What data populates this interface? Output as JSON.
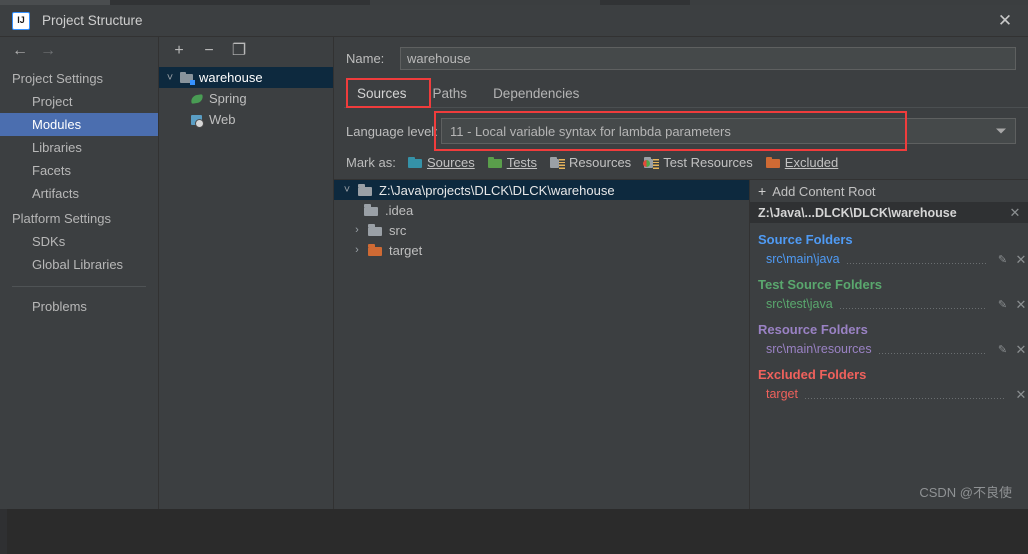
{
  "window": {
    "title": "Project Structure",
    "app_icon": "intellij-idea-icon",
    "close_label": "✕"
  },
  "nav": {
    "back_icon": "arrow-left-icon",
    "forward_icon": "arrow-right-icon"
  },
  "sidebar": {
    "groups": [
      {
        "label": "Project Settings",
        "items": [
          {
            "label": "Project",
            "selected": false
          },
          {
            "label": "Modules",
            "selected": true
          },
          {
            "label": "Libraries",
            "selected": false
          },
          {
            "label": "Facets",
            "selected": false
          },
          {
            "label": "Artifacts",
            "selected": false
          }
        ]
      },
      {
        "label": "Platform Settings",
        "items": [
          {
            "label": "SDKs",
            "selected": false
          },
          {
            "label": "Global Libraries",
            "selected": false
          }
        ]
      }
    ],
    "problems": {
      "label": "Problems"
    }
  },
  "modules_panel": {
    "toolbar": {
      "add": "+",
      "remove": "−",
      "copy": "❐"
    },
    "tree": [
      {
        "label": "warehouse",
        "icon": "module-folder-icon",
        "expanded": true,
        "selected": true,
        "level": 0
      },
      {
        "label": "Spring",
        "icon": "spring-leaf-icon",
        "level": 1
      },
      {
        "label": "Web",
        "icon": "web-icon",
        "level": 1
      }
    ]
  },
  "main": {
    "name": {
      "label": "Name:",
      "value": "warehouse"
    },
    "tabs": [
      {
        "label": "Sources",
        "active": true,
        "highlighted": true
      },
      {
        "label": "Paths",
        "active": false
      },
      {
        "label": "Dependencies",
        "active": false
      }
    ],
    "language_level": {
      "label": "Language level:",
      "value": "11 - Local variable syntax for lambda parameters",
      "highlighted": true,
      "arrow_icon": "chevron-down-icon"
    },
    "mark_as": {
      "label": "Mark as:",
      "buttons": [
        {
          "label": "Sources",
          "mnemonic": "S",
          "color": "#3592a8"
        },
        {
          "label": "Tests",
          "mnemonic": "T",
          "color": "#5a9e4b"
        },
        {
          "label": "Resources",
          "mnemonic": "",
          "color": "#9aa0a6"
        },
        {
          "label": "Test Resources",
          "mnemonic": "",
          "color": "#9aa0a6"
        },
        {
          "label": "Excluded",
          "mnemonic": "E",
          "color": "#cf6a34"
        }
      ]
    },
    "content_tree": [
      {
        "label": "Z:\\Java\\projects\\DLCK\\DLCK\\warehouse",
        "level": 0,
        "expanded": true,
        "selected": true,
        "folder_color": "gray",
        "has_toggle": true
      },
      {
        "label": ".idea",
        "level": 1,
        "folder_color": "gray",
        "has_toggle": false
      },
      {
        "label": "src",
        "level": 1,
        "folder_color": "gray",
        "has_toggle": true
      },
      {
        "label": "target",
        "level": 1,
        "folder_color": "orange",
        "has_toggle": true
      }
    ]
  },
  "details": {
    "add_content_root": "Add Content Root",
    "root_path": "Z:\\Java\\...DLCK\\DLCK\\warehouse",
    "groups": [
      {
        "title": "Source Folders",
        "color": "#4f9bf5",
        "items": [
          {
            "path": "src\\main\\java",
            "has_edit": true,
            "has_remove": true
          }
        ]
      },
      {
        "title": "Test Source Folders",
        "color": "#5aa86e",
        "items": [
          {
            "path": "src\\test\\java",
            "has_edit": true,
            "has_remove": true
          }
        ]
      },
      {
        "title": "Resource Folders",
        "color": "#9a82c4",
        "items": [
          {
            "path": "src\\main\\resources",
            "has_edit": true,
            "has_remove": true
          }
        ]
      },
      {
        "title": "Excluded Folders",
        "color": "#f0615c",
        "items": [
          {
            "path": "target",
            "has_edit": false,
            "has_remove": true
          }
        ]
      }
    ]
  },
  "watermark": "CSDN @不良使",
  "colors": {
    "dialog_bg": "#3c3f41",
    "selection_blue": "#4b6eaf",
    "tree_selection": "#0d293e",
    "highlight_red": "#f03c3c",
    "field_bg": "#45494a"
  }
}
